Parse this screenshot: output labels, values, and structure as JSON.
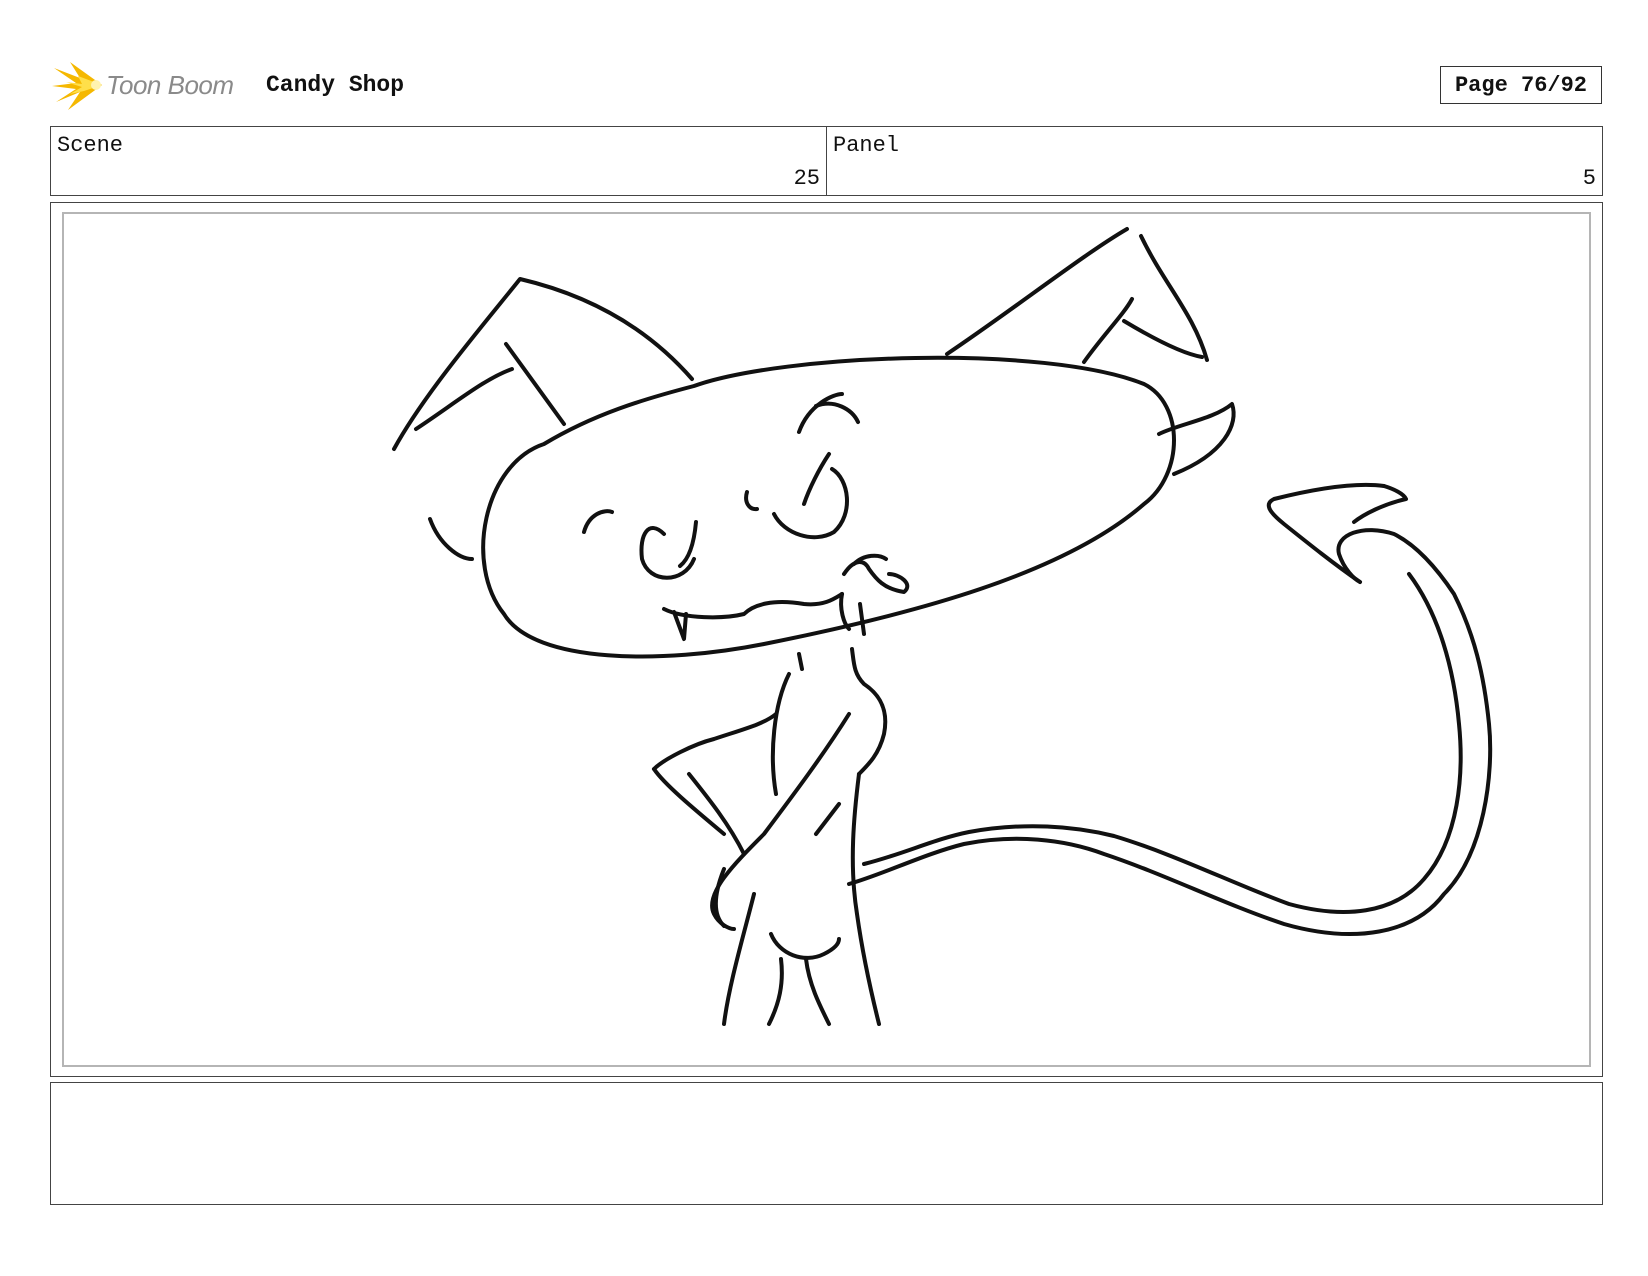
{
  "header": {
    "logo_text": "Toon Boom",
    "project_title": "Candy Shop",
    "page_label": "Page 76/92"
  },
  "info": {
    "scene_label": "Scene",
    "scene_value": "25",
    "panel_label": "Panel",
    "panel_value": "5"
  },
  "colors": {
    "logo_flare": "#f5b800",
    "logo_text": "#8a8a8a",
    "frame_border": "#b5b5b5"
  },
  "icons": {
    "logo": "toon-boom-flare-icon"
  },
  "panel": {
    "drawing": "line-sketch-character"
  },
  "notes": {
    "text": ""
  }
}
